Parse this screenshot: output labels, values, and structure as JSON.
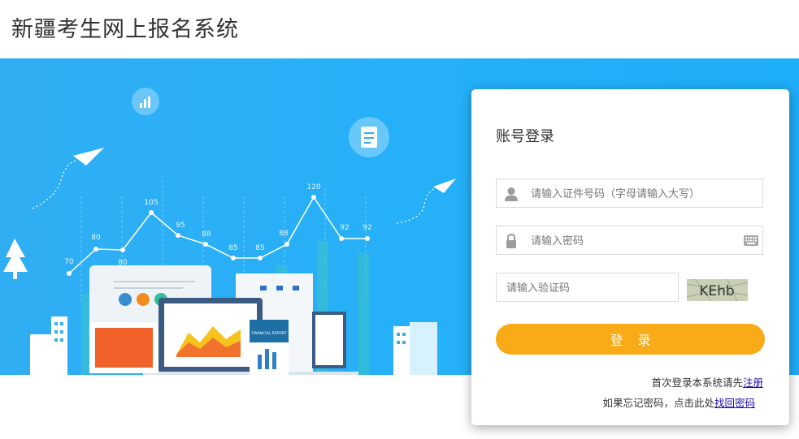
{
  "header": {
    "title": "新疆考生网上报名系统"
  },
  "banner": {
    "chart_labels": [
      "70",
      "80",
      "80",
      "105",
      "95",
      "88",
      "85",
      "85",
      "88",
      "120",
      "92",
      "92"
    ],
    "report_label": "FINANCIAL REPORT"
  },
  "login": {
    "title": "账号登录",
    "id_placeholder": "请输入证件号码（字母请输入大写）",
    "password_placeholder": "请输入密码",
    "captcha_placeholder": "请输入验证码",
    "captcha_text": "KEhb",
    "submit_label": "登录",
    "register_prompt": "首次登录本系统请先",
    "register_link": "注册",
    "forgot_prompt": "如果忘记密码，点击此处",
    "forgot_link": "找回密码"
  },
  "colors": {
    "banner": "#25b0f8",
    "button": "#f8aa17",
    "link": "#1a0dab"
  }
}
